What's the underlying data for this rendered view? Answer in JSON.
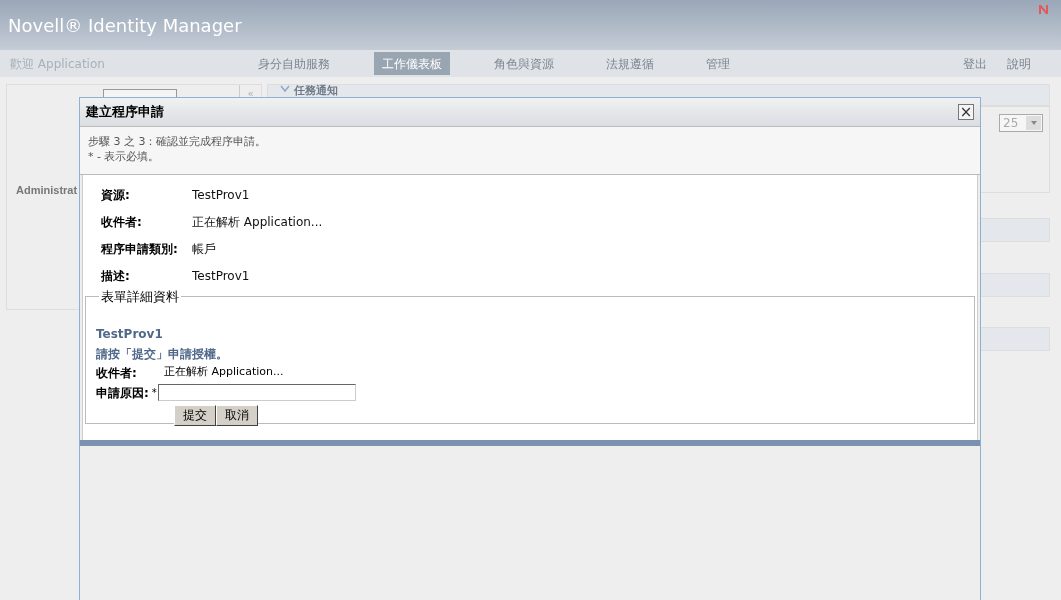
{
  "header": {
    "title": "Novell® Identity Manager"
  },
  "nav": {
    "welcome": "歡迎 Application",
    "tabs": [
      {
        "label": "身分自助服務",
        "selected": false
      },
      {
        "label": "工作儀表板",
        "selected": true
      },
      {
        "label": "角色與資源",
        "selected": false
      },
      {
        "label": "法規遵循",
        "selected": false
      },
      {
        "label": "管理",
        "selected": false
      }
    ],
    "links": [
      "登出",
      "說明"
    ]
  },
  "background": {
    "user_label": "Administrat",
    "collapse": "«",
    "section_title": "任務通知",
    "page_size": "25"
  },
  "dialog": {
    "title": "建立程序申請",
    "close": "×",
    "step": "步驟 3 之 3：確認並完成程序申請。",
    "required_note": "* - 表示必填。",
    "summary": [
      {
        "label": "資源:",
        "value": "TestProv1"
      },
      {
        "label": "收件者:",
        "value": "正在解析 Application..."
      },
      {
        "label": "程序申請類別:",
        "value": "帳戶"
      },
      {
        "label": "描述:",
        "value": "TestProv1"
      }
    ],
    "form": {
      "legend": "表單詳細資料",
      "name": "TestProv1",
      "instruction": "請按「提交」申請授權。",
      "recipient_label": "收件者:",
      "recipient_value": "正在解析 Application...",
      "reason_label": "申請原因:",
      "required_mark": "*",
      "buttons": [
        "提交",
        "取消"
      ]
    }
  }
}
